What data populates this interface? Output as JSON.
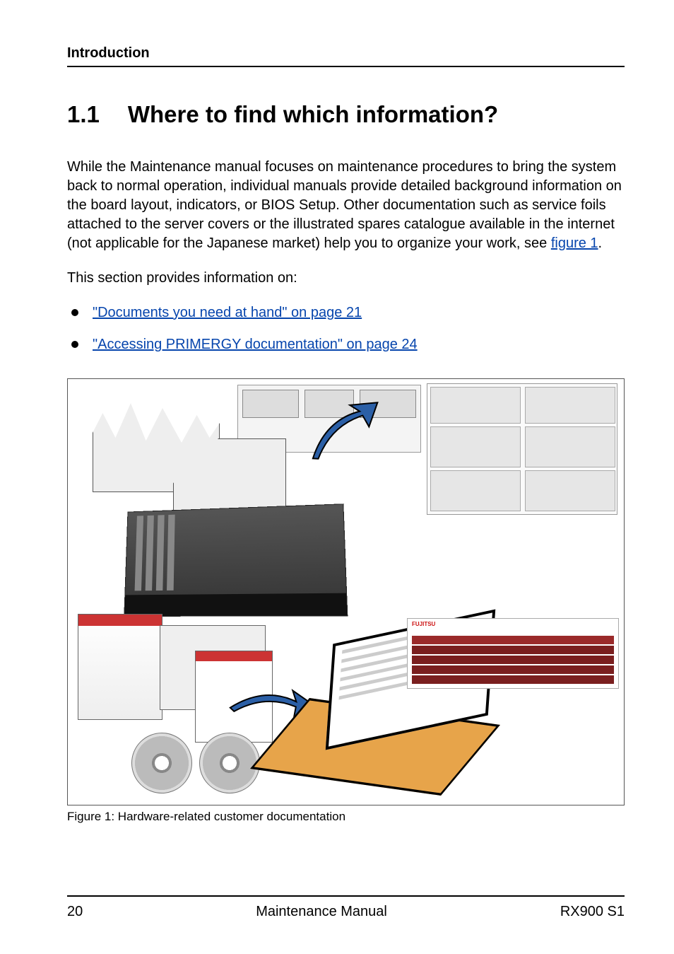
{
  "running_head": "Introduction",
  "section": {
    "number": "1.1",
    "title": "Where to find which information?"
  },
  "para1_pre": "While the Maintenance manual focuses on maintenance procedures to bring the system back to normal operation, individual manuals provide detailed background information on the board layout, indicators, or BIOS Setup. Other documentation such as service foils attached to the server covers or the illustrated spares catalogue available in the internet (not applicable for the Japanese market) help you to organize your work, see ",
  "para1_link": "figure 1",
  "para1_post": ".",
  "para2": "This section provides information on:",
  "bullets": [
    "\"Documents you need at hand\" on page 21",
    "\"Accessing PRIMERGY documentation\" on page 24"
  ],
  "figure": {
    "caption": "Figure 1: Hardware-related customer documentation",
    "brand_text": "FUJITSU"
  },
  "footer": {
    "page": "20",
    "center": "Maintenance Manual",
    "right": "RX900 S1"
  }
}
